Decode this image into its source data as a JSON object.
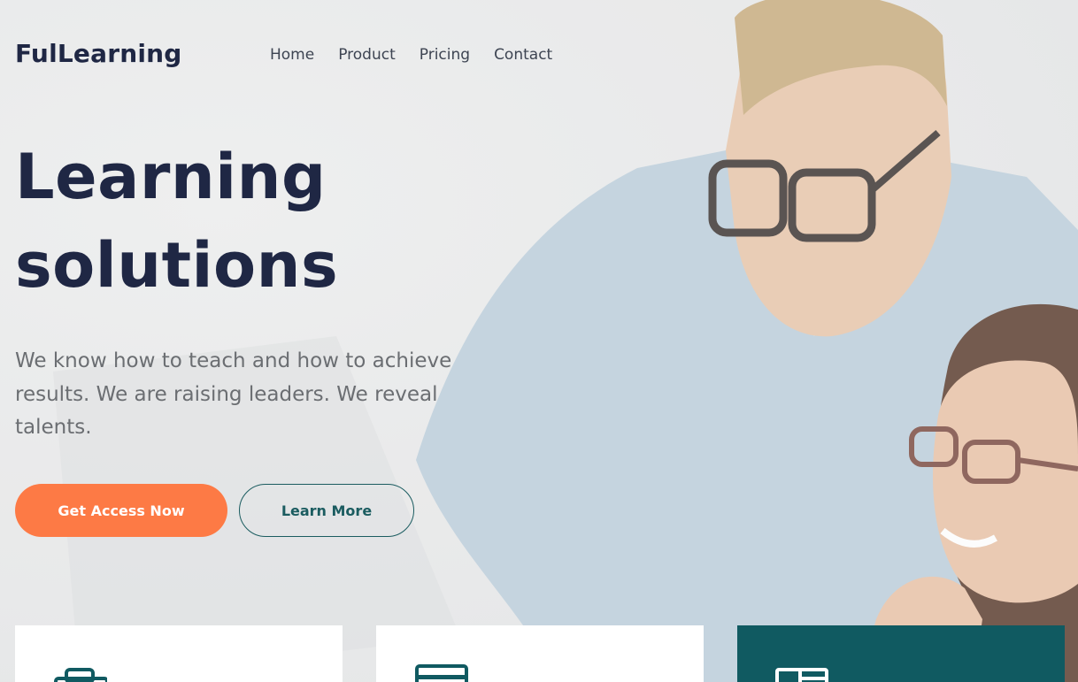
{
  "brand": {
    "logo": "FulLearning"
  },
  "nav": [
    {
      "label": "Home"
    },
    {
      "label": "Product"
    },
    {
      "label": "Pricing"
    },
    {
      "label": "Contact"
    }
  ],
  "hero": {
    "title_line1": "Learning",
    "title_line2": "solutions",
    "description": "We know how to teach and how to achieve results. We are raising leaders. We reveal talents.",
    "primary_button": "Get Access Now",
    "secondary_button": "Learn More"
  },
  "cards": [
    {
      "icon": "briefcase-icon"
    },
    {
      "icon": "printer-icon"
    },
    {
      "icon": "layout-icon"
    }
  ],
  "colors": {
    "navy": "#1f2744",
    "orange": "#fd7a45",
    "teal": "#105a61",
    "gray_text": "#6b6e72"
  }
}
